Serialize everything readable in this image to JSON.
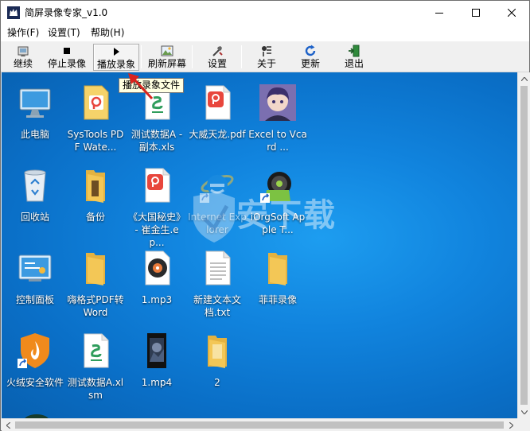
{
  "window": {
    "title": "简屏录像专家_v1.0",
    "controls": {
      "minimize": "minimize",
      "maximize": "maximize",
      "close": "close"
    }
  },
  "menu": [
    "操作(F)",
    "设置(T)",
    "帮助(H)"
  ],
  "toolbar": {
    "buttons": [
      {
        "label": "继续",
        "icon": "resume-icon"
      },
      {
        "label": "停止录像",
        "icon": "stop-icon"
      },
      {
        "label": "播放录象",
        "icon": "play-icon",
        "pressed": true
      },
      {
        "label": "刷新屏幕",
        "icon": "refresh-screen-icon"
      },
      {
        "label": "设置",
        "icon": "settings-icon"
      },
      {
        "label": "关于",
        "icon": "about-icon"
      },
      {
        "label": "更新",
        "icon": "update-icon"
      },
      {
        "label": "退出",
        "icon": "exit-icon"
      }
    ]
  },
  "tooltip": "播放录象文件",
  "desktop": {
    "icons": [
      {
        "label": "此电脑",
        "type": "this-pc-icon"
      },
      {
        "label": "SysTools PDF Wate...",
        "type": "pdf-file-icon"
      },
      {
        "label": "测试数据A - 副本.xls",
        "type": "spreadsheet-file-icon"
      },
      {
        "label": "大威天龙.pdf",
        "type": "pdf-file-icon"
      },
      {
        "label": "Excel to Vcard ...",
        "type": "app-shortcut-icon"
      },
      {
        "label": "回收站",
        "type": "recycle-bin-icon"
      },
      {
        "label": "备份",
        "type": "folder-icon"
      },
      {
        "label": "《大国秘史》 - 崔金生.ep...",
        "type": "pdf-file-icon"
      },
      {
        "label": "Internet Explorer",
        "type": "internet-explorer-icon"
      },
      {
        "label": "iOrgSoft Apple T...",
        "type": "app-shortcut-icon"
      },
      {
        "label": "控制面板",
        "type": "control-panel-icon"
      },
      {
        "label": "嗨格式PDF转Word",
        "type": "folder-icon"
      },
      {
        "label": "1.mp3",
        "type": "audio-file-icon"
      },
      {
        "label": "新建文本文档.txt",
        "type": "text-file-icon"
      },
      {
        "label": "菲菲录像",
        "type": "folder-icon"
      },
      {
        "label": "火绒安全软件",
        "type": "huorong-shortcut-icon"
      },
      {
        "label": "测试数据A.xlsm",
        "type": "spreadsheet-file-icon"
      },
      {
        "label": "1.mp4",
        "type": "video-file-icon"
      },
      {
        "label": "2",
        "type": "folder-icon"
      }
    ]
  },
  "watermark": "安下载",
  "colors": {
    "desktop": "#1184de",
    "pdf_red": "#e8463c",
    "wps_green": "#2f9d5c",
    "folder": "#f3c756",
    "tooltip_bg": "#ffffe1"
  }
}
